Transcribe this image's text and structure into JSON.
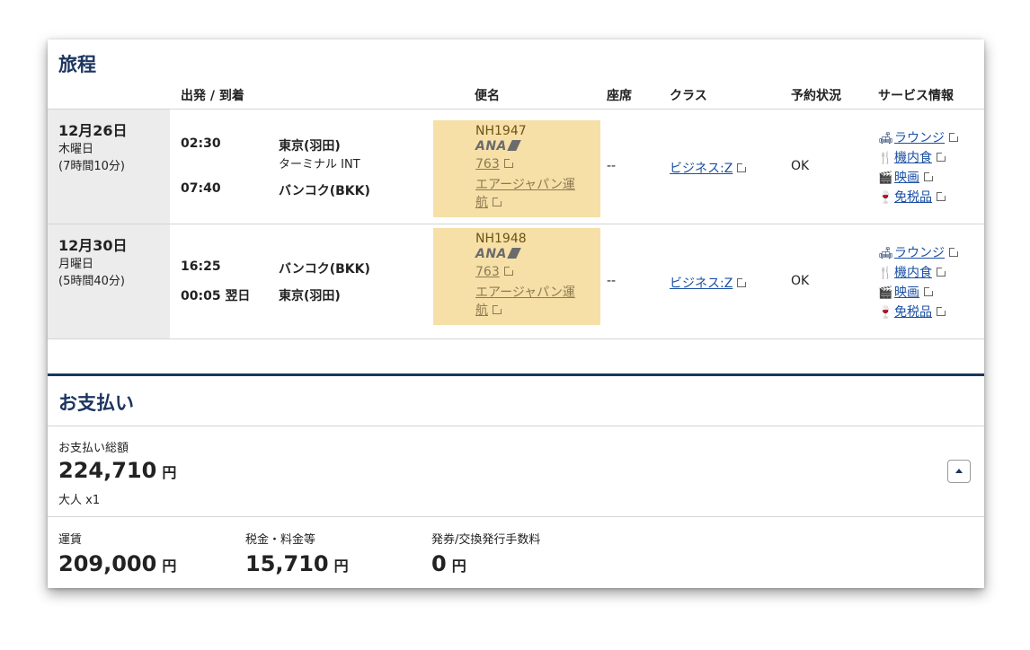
{
  "itinerary": {
    "title": "旅程",
    "headers": {
      "depart_arrive": "出発 / 到着",
      "flight": "便名",
      "seat": "座席",
      "class": "クラス",
      "status": "予約状況",
      "service": "サービス情報"
    },
    "segments": [
      {
        "date": "12月26日",
        "weekday": "木曜日",
        "duration": "(7時間10分)",
        "dep_time": "02:30",
        "dep_place": "東京(羽田)",
        "dep_terminal": "ターミナル INT",
        "arr_time": "07:40",
        "arr_place": "バンコク(BKK)",
        "flight_no": "NH1947",
        "airline_logo": "ANA",
        "aircraft": "763",
        "operator_line1": "エアージャパン運",
        "operator_line2": "航",
        "seat": "--",
        "class": "ビジネス:Z",
        "status": "OK"
      },
      {
        "date": "12月30日",
        "weekday": "月曜日",
        "duration": "(5時間40分)",
        "dep_time": "16:25",
        "dep_place": "バンコク(BKK)",
        "arr_time": "00:05 翌日",
        "arr_place": "東京(羽田)",
        "flight_no": "NH1948",
        "airline_logo": "ANA",
        "aircraft": "763",
        "operator_line1": "エアージャパン運",
        "operator_line2": "航",
        "seat": "--",
        "class": "ビジネス:Z",
        "status": "OK"
      }
    ],
    "services": [
      {
        "icon": "lounge-icon",
        "glyph": "🛋",
        "label": "ラウンジ"
      },
      {
        "icon": "meal-icon",
        "glyph": "🍴",
        "label": "機内食"
      },
      {
        "icon": "movie-icon",
        "glyph": "🎬",
        "label": "映画"
      },
      {
        "icon": "duty-free-icon",
        "glyph": "🍷",
        "label": "免税品"
      }
    ]
  },
  "payment": {
    "title": "お支払い",
    "total_label": "お支払い総額",
    "total_amount": "224,710",
    "currency": "円",
    "passengers": "大人 x1",
    "fare_label": "運賃",
    "fare_amount": "209,000",
    "tax_label": "税金・料金等",
    "tax_amount": "15,710",
    "fee_label": "発券/交換発行手数料",
    "fee_amount": "0"
  },
  "colors": {
    "accent": "#1c3560",
    "link": "#1a4fa3",
    "flight_highlight": "#f6e0a8",
    "date_cell": "#ececec"
  }
}
